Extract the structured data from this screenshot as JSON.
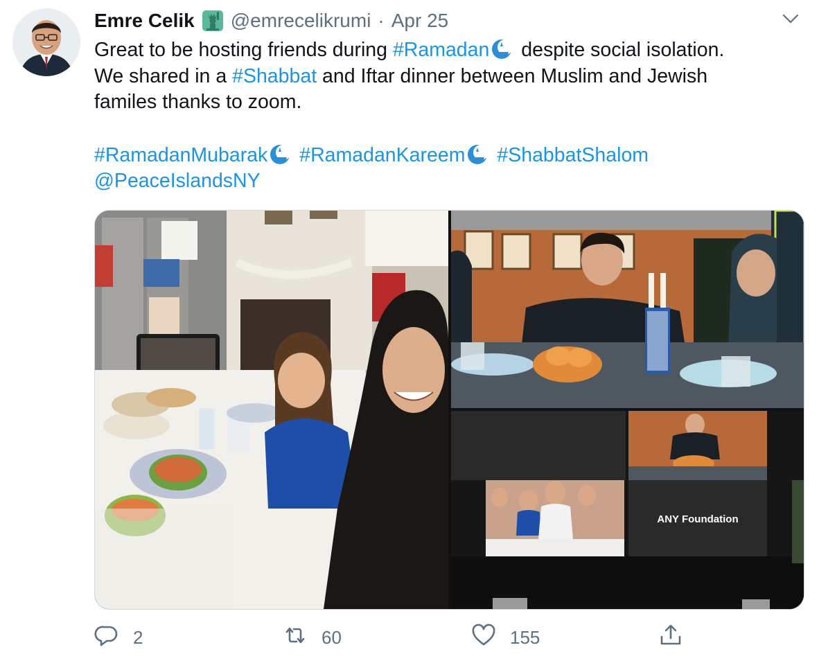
{
  "author": {
    "name": "Emre Celik",
    "handle": "@emrecelikrumi",
    "separator": "·",
    "date": "Apr 25"
  },
  "tweet": {
    "line1_a": "Great to be hosting friends during ",
    "line1_tag": "#Ramadan",
    "line1_b": " despite social isolation.",
    "line2_a": "We shared in a ",
    "line2_tag": "#Shabbat",
    "line2_b": " and Iftar dinner between Muslim and Jewish",
    "line3": "familes thanks to zoom.",
    "hashtag1": "#RamadanMubarak",
    "hashtag2": "#RamadanKareem",
    "hashtag3": "#ShabbatShalom",
    "mention": "@PeaceIslandsNY"
  },
  "media": {
    "zoom_tile_label": "ANY Foundation"
  },
  "actions": {
    "replies": "2",
    "retweets": "60",
    "likes": "155"
  },
  "icons": {
    "verified_style_badge": "statue-of-liberty-emoji",
    "hashtag_emoji": "crescent-moon-lamp",
    "reply": "reply-icon",
    "retweet": "retweet-icon",
    "like": "heart-icon",
    "share": "share-icon",
    "more": "chevron-down-icon"
  },
  "colors": {
    "link": "#1b95e0",
    "text": "#0f1419",
    "muted": "#5b7083"
  }
}
